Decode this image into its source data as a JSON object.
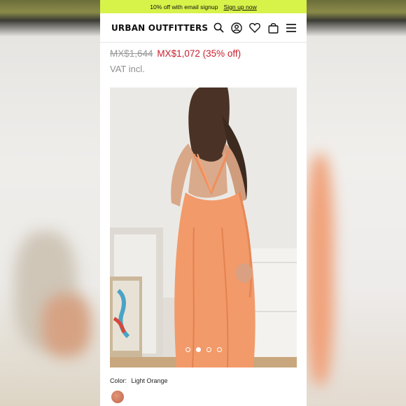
{
  "promo": {
    "text": "10% off with email signup",
    "link": "Sign up now"
  },
  "header": {
    "logo": "URBAN OUTFITTERS",
    "icons": [
      "search-icon",
      "account-icon",
      "heart-icon",
      "bag-icon",
      "menu-icon"
    ]
  },
  "product": {
    "old_price": "MX$1,644",
    "new_price": "MX$1,072 (35% off)",
    "vat": "VAT incl.",
    "gallery": {
      "count": 4,
      "active_index": 1
    },
    "color_label": "Color:",
    "color_value": "Light Orange"
  },
  "colors": {
    "promo_bg": "#d7f34a",
    "sale_red": "#c8202f",
    "garment": "#f29a6a"
  }
}
